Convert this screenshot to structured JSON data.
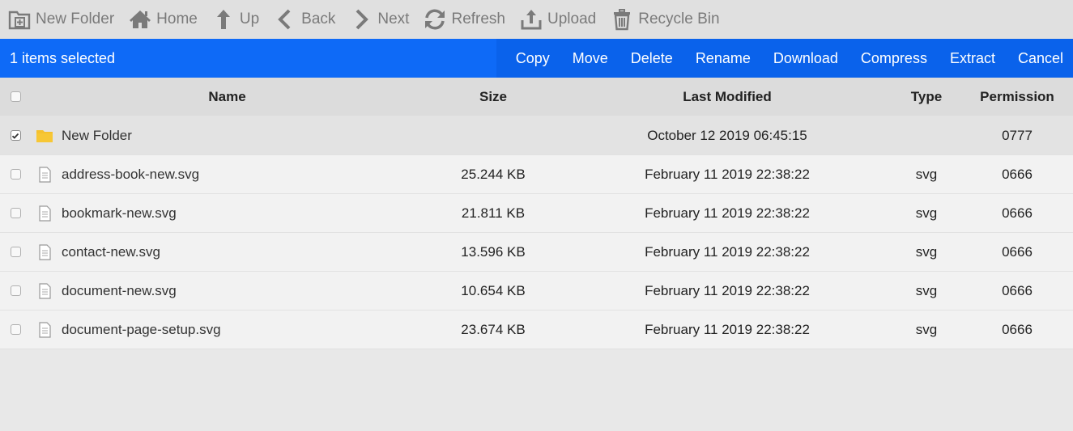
{
  "toolbar": {
    "items": [
      {
        "label": "New Folder",
        "icon": "new-folder-icon"
      },
      {
        "label": "Home",
        "icon": "home-icon"
      },
      {
        "label": "Up",
        "icon": "up-arrow-icon"
      },
      {
        "label": "Back",
        "icon": "back-chevron-icon"
      },
      {
        "label": "Next",
        "icon": "next-chevron-icon"
      },
      {
        "label": "Refresh",
        "icon": "refresh-icon"
      },
      {
        "label": "Upload",
        "icon": "upload-icon"
      },
      {
        "label": "Recycle Bin",
        "icon": "trash-icon"
      }
    ]
  },
  "selection": {
    "count_text": "1 items selected",
    "actions": [
      "Copy",
      "Move",
      "Delete",
      "Rename",
      "Download",
      "Compress",
      "Extract",
      "Cancel"
    ]
  },
  "table": {
    "headers": {
      "name": "Name",
      "size": "Size",
      "modified": "Last Modified",
      "type": "Type",
      "permission": "Permission"
    },
    "rows": [
      {
        "name": "New Folder",
        "size": "",
        "modified": "October 12 2019 06:45:15",
        "type": "",
        "permission": "0777",
        "kind": "folder",
        "checked": true
      },
      {
        "name": "address-book-new.svg",
        "size": "25.244 KB",
        "modified": "February 11 2019 22:38:22",
        "type": "svg",
        "permission": "0666",
        "kind": "file",
        "checked": false
      },
      {
        "name": "bookmark-new.svg",
        "size": "21.811 KB",
        "modified": "February 11 2019 22:38:22",
        "type": "svg",
        "permission": "0666",
        "kind": "file",
        "checked": false
      },
      {
        "name": "contact-new.svg",
        "size": "13.596 KB",
        "modified": "February 11 2019 22:38:22",
        "type": "svg",
        "permission": "0666",
        "kind": "file",
        "checked": false
      },
      {
        "name": "document-new.svg",
        "size": "10.654 KB",
        "modified": "February 11 2019 22:38:22",
        "type": "svg",
        "permission": "0666",
        "kind": "file",
        "checked": false
      },
      {
        "name": "document-page-setup.svg",
        "size": "23.674 KB",
        "modified": "February 11 2019 22:38:22",
        "type": "svg",
        "permission": "0666",
        "kind": "file",
        "checked": false
      }
    ]
  },
  "colors": {
    "accent": "#0e6af7",
    "folder": "#f5c12e"
  }
}
